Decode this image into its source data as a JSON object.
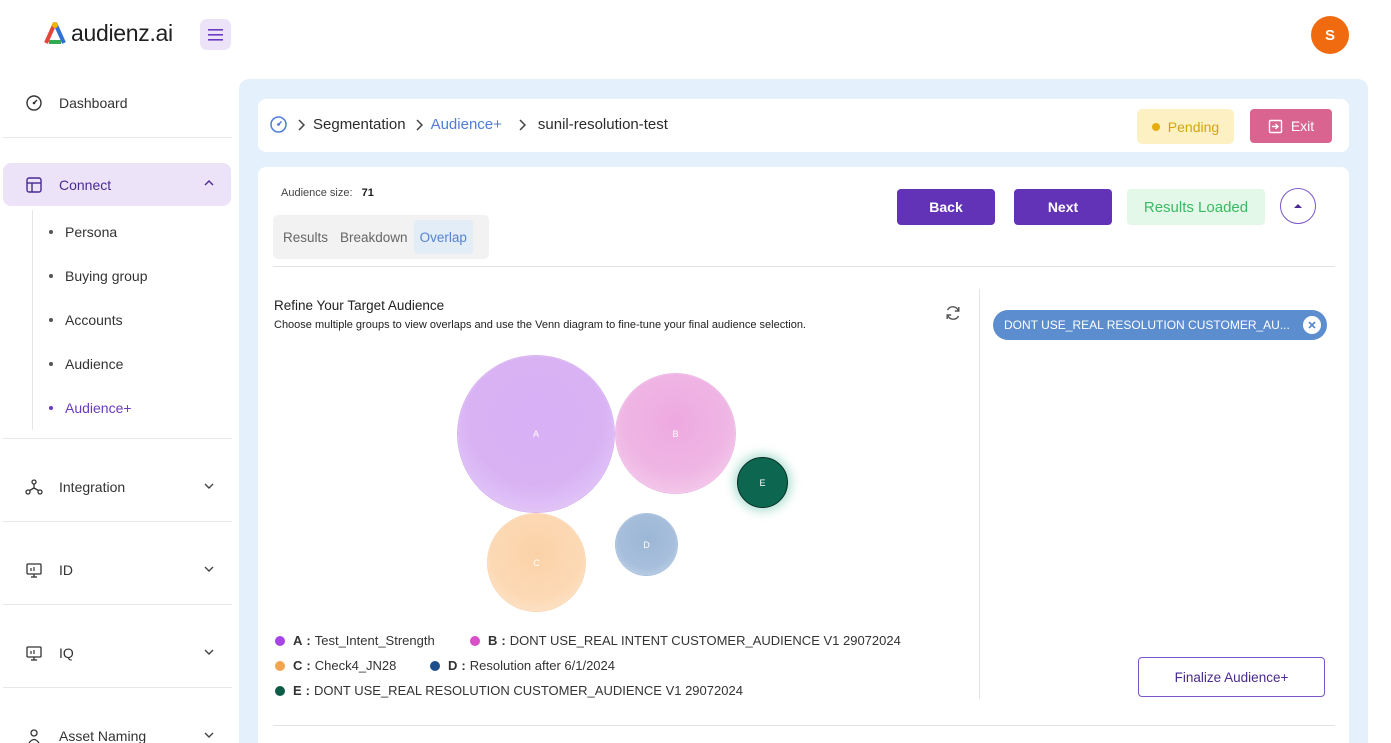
{
  "header": {
    "logo_text": "audienz.ai",
    "avatar_initial": "S"
  },
  "sidebar": {
    "dashboard": "Dashboard",
    "connect": "Connect",
    "connect_items": [
      "Persona",
      "Buying group",
      "Accounts",
      "Audience",
      "Audience+"
    ],
    "integration": "Integration",
    "id": "ID",
    "iq": "IQ",
    "asset_naming": "Asset Naming"
  },
  "breadcrumb": {
    "segmentation": "Segmentation",
    "audience_plus": "Audience+",
    "current": "sunil-resolution-test"
  },
  "status": {
    "pending": "Pending",
    "exit": "Exit",
    "results_loaded": "Results Loaded"
  },
  "audience": {
    "size_label": "Audience size:",
    "size_value": "71"
  },
  "tabs": [
    "Results",
    "Breakdown",
    "Overlap"
  ],
  "actions": {
    "back": "Back",
    "next": "Next",
    "finalize": "Finalize Audience+"
  },
  "refine": {
    "title": "Refine Your Target Audience",
    "subtitle": "Choose multiple groups to view overlaps and use the Venn diagram to fine-tune your final audience selection."
  },
  "venn": {
    "groups": [
      {
        "key": "A",
        "name": "Test_Intent_Strength",
        "color": "#a744e6"
      },
      {
        "key": "B",
        "name": "DONT USE_REAL INTENT CUSTOMER_AUDIENCE V1 29072024",
        "color": "#d84fc8"
      },
      {
        "key": "C",
        "name": "Check4_JN28",
        "color": "#f3a54e"
      },
      {
        "key": "D",
        "name": "Resolution after 6/1/2024",
        "color": "#1e4f8c"
      },
      {
        "key": "E",
        "name": "DONT USE_REAL RESOLUTION CUSTOMER_AUDIENCE V1 29072024",
        "color": "#0c5c48"
      }
    ]
  },
  "selection": {
    "chip": "DONT USE_REAL RESOLUTION CUSTOMER_AU..."
  }
}
